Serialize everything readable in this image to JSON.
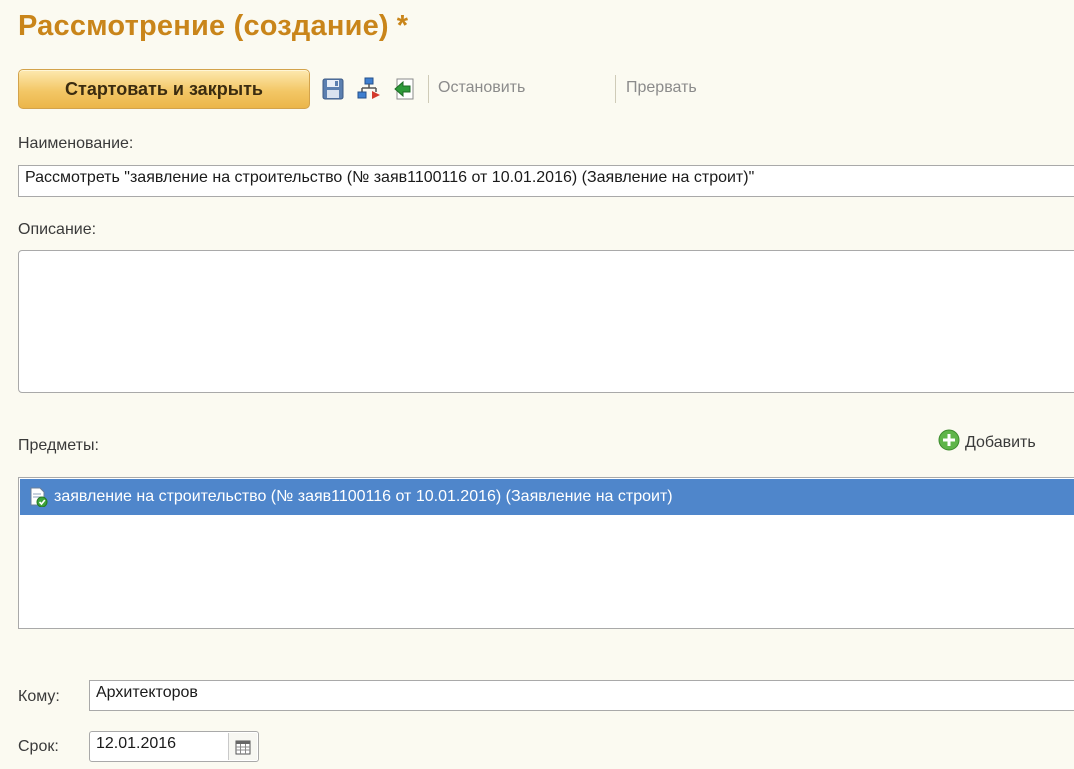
{
  "window": {
    "title": "Рассмотрение (создание)",
    "modified_marker": "*"
  },
  "toolbar": {
    "start_close_label": "Стартовать и закрыть",
    "stop_label": "Остановить",
    "abort_label": "Прервать",
    "icons": [
      "save-icon",
      "route-icon",
      "back-icon"
    ]
  },
  "form": {
    "name_label": "Наименование:",
    "name_value": "Рассмотреть \"заявление на строительство (№ заяв1100116 от 10.01.2016) (Заявление на строит)\"",
    "description_label": "Описание:",
    "description_value": "",
    "subjects_label": "Предметы:",
    "add_label": "Добавить",
    "subjects": [
      {
        "label": "заявление на строительство (№ заяв1100116 от 10.01.2016) (Заявление на строит)",
        "selected": true
      }
    ],
    "to_label": "Кому:",
    "to_value": "Архитекторов",
    "deadline_label": "Срок:",
    "deadline_value": "12.01.2016"
  },
  "colors": {
    "title": "#c9851a",
    "background": "#fbfaf1",
    "selection": "#4f86cb",
    "button": "#f3c766"
  }
}
